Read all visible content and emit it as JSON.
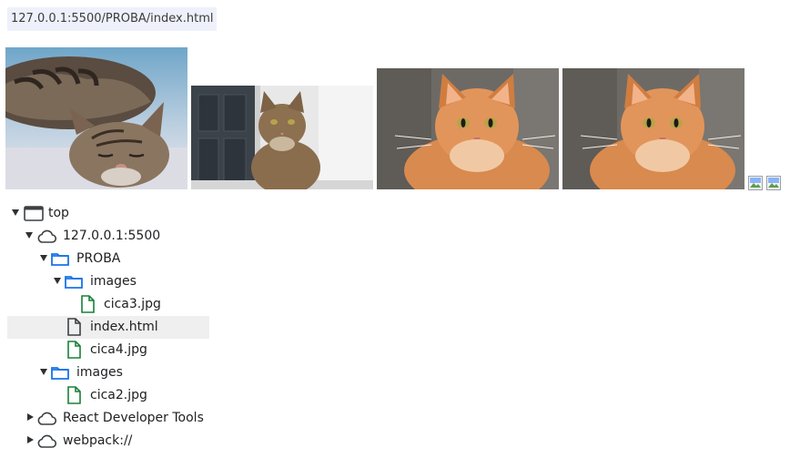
{
  "address_bar": {
    "url": "127.0.0.1:5500/PROBA/index.html"
  },
  "images": [
    {
      "name": "sleeping-tabby-cat",
      "broken": false
    },
    {
      "name": "tabby-cat-at-door",
      "broken": false
    },
    {
      "name": "fluffy-ginger-cat",
      "broken": false
    },
    {
      "name": "fluffy-ginger-cat",
      "broken": false
    },
    {
      "name": "broken-image",
      "broken": true
    },
    {
      "name": "broken-image",
      "broken": true
    }
  ],
  "tree": [
    {
      "label": "top",
      "icon": "frame-icon",
      "expanded": true,
      "level": 0
    },
    {
      "label": "127.0.0.1:5500",
      "icon": "cloud-icon",
      "expanded": true,
      "level": 1
    },
    {
      "label": "PROBA",
      "icon": "folder-icon",
      "expanded": true,
      "level": 2
    },
    {
      "label": "images",
      "icon": "folder-icon",
      "expanded": true,
      "level": 3
    },
    {
      "label": "cica3.jpg",
      "icon": "image-file-icon",
      "level": 4
    },
    {
      "label": "index.html",
      "icon": "document-file-icon",
      "level": 3,
      "selected": true
    },
    {
      "label": "cica4.jpg",
      "icon": "image-file-icon",
      "level": 3
    },
    {
      "label": "images",
      "icon": "folder-icon",
      "expanded": true,
      "level": 2
    },
    {
      "label": "cica2.jpg",
      "icon": "image-file-icon",
      "level": 3
    },
    {
      "label": "React Developer Tools",
      "icon": "cloud-icon",
      "expanded": false,
      "level": 1
    },
    {
      "label": "webpack://",
      "icon": "cloud-icon",
      "expanded": false,
      "level": 1
    }
  ],
  "colors": {
    "folder": "#1a73e8",
    "image_file": "#188038",
    "document_file": "#5f6368",
    "selected_row": "#efefef"
  }
}
